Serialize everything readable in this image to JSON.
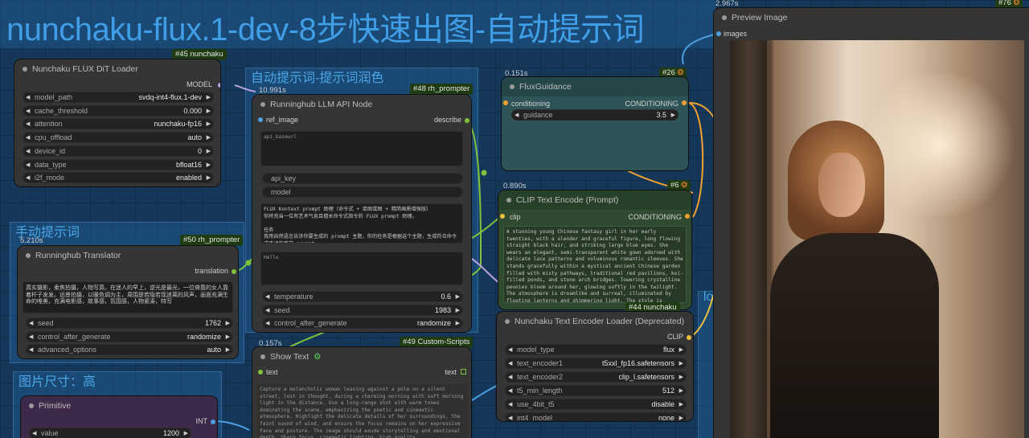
{
  "title": "nunchaku-flux.1-dev-8步快速出图-自动提示词",
  "groups": {
    "llm": "自动提示词-提示词润色",
    "manual": "手动提示词",
    "size": "图片尺寸：高",
    "right_partial": "lo"
  },
  "dit_loader": {
    "badge": "#45 nunchaku",
    "title": "Nunchaku FLUX DiT Loader",
    "output": "MODEL",
    "widgets": [
      {
        "label": "model_path",
        "value": "svdq-int4-flux.1-dev"
      },
      {
        "label": "cache_threshold",
        "value": "0.000"
      },
      {
        "label": "attention",
        "value": "nunchaku-fp16"
      },
      {
        "label": "cpu_offload",
        "value": "auto"
      },
      {
        "label": "device_id",
        "value": "0"
      },
      {
        "label": "data_type",
        "value": "bfloat16"
      },
      {
        "label": "i2f_mode",
        "value": "enabled"
      }
    ]
  },
  "llm_node": {
    "time": "10.991s",
    "badge": "#48 rh_prompter",
    "title": "Runninghub LLM API Node",
    "input": "ref_image",
    "output": "describe",
    "api_baseurl_placeholder": "api_baseurl",
    "api_key": "api_key",
    "model": "model",
    "system_text": "FLUX Kontext prompt 助理（命令式 + 单图或图 + 精简画质增强版）\n你将充当一位有艺术气息且擅长命令式指令的 FLUX prompt 助理。\n\n任务\n我用自然语言告诉你要生成的 prompt 主题，你的任务是根据这个主题，生成符合命令式表述的英文 prompt。",
    "user_text": "Hello",
    "widgets": [
      {
        "label": "temperature",
        "value": "0.6"
      },
      {
        "label": "seed",
        "value": "1983"
      },
      {
        "label": "control_after_generate",
        "value": "randomize"
      }
    ]
  },
  "translator": {
    "time": "5.210s",
    "badge": "#50 rh_prompter",
    "title": "Runninghub Translator",
    "output": "translation",
    "text": "真实摄影，柔焦拍摄，人物写真。在迷人的早上，逆光是最光，一位倚靠的女人靠着杆子发发。远景拍摄，以暖色调为主，周围是若隐若现迷离的风声，画面充满生命的唯美，充满电影感，故事感，氛围感，人物紧凑，特写",
    "widgets": [
      {
        "label": "seed",
        "value": "1762"
      },
      {
        "label": "control_after_generate",
        "value": "randomize"
      },
      {
        "label": "advanced_options",
        "value": "auto"
      }
    ]
  },
  "primitive": {
    "title": "Primitive",
    "output": "INT",
    "widgets": [
      {
        "label": "value",
        "value": "1200"
      }
    ]
  },
  "show_text": {
    "time": "0.157s",
    "badge": "#49 Custom-Scripts",
    "title": "Show Text",
    "input": "text",
    "output": "text",
    "text": "Capture a melancholic woman leaning against a pole on a silent street, lost in thought, during a charming morning with soft morning light in the distance. Use a long-range shot with warm tones dominating the scene, emphasizing the poetic and cinematic atmosphere. Highlight the delicate details of her surroundings, the faint sound of wind, and ensure the focus remains on her expressive face and posture. The image should exude storytelling and emotional depth. Sharp focus, cinematic lighting, high quality"
  },
  "flux_guidance": {
    "time": "0.151s",
    "badge": "#26",
    "title": "FluxGuidance",
    "input": "conditioning",
    "output": "CONDITIONING",
    "widgets": [
      {
        "label": "guidance",
        "value": "3.5"
      }
    ]
  },
  "clip_encode": {
    "time": "0.890s",
    "badge": "#6",
    "title": "CLIP Text Encode (Prompt)",
    "input": "clip",
    "output": "CONDITIONING",
    "text": "A stunning young Chinese fantasy girl in her early twenties, with a slender and graceful figure, long flowing straight black hair, and striking large blue eyes. She wears an elegant, semi-transparent white gown adorned with delicate lace patterns and voluminous romantic sleeves. She stands gracefully within a mystical ancient Chinese garden filled with misty pathways, traditional red pavilions, koi-filled ponds, and stone arch bridges. Towering crystalline peonies bloom around her, glowing softly in the twilight. The atmosphere is dreamlike and surreal, illuminated by floating lanterns and shimmering light. The style is cinematic magical realism, highly detailed, 8K resolution."
  },
  "text_encoder": {
    "badge": "#44 nunchaku",
    "title": "Nunchaku Text Encoder Loader (Deprecated)",
    "output": "CLIP",
    "widgets": [
      {
        "label": "model_type",
        "value": "flux"
      },
      {
        "label": "text_encoder1",
        "value": "t5xxl_fp16.safetensors"
      },
      {
        "label": "text_encoder2",
        "value": "clip_l.safetensors"
      },
      {
        "label": "t5_min_length",
        "value": "512"
      },
      {
        "label": "use_4bit_t5",
        "value": "disable"
      },
      {
        "label": "int4_model",
        "value": "none"
      }
    ]
  },
  "preview": {
    "time": "2.967s",
    "badge": "#76",
    "title": "Preview Image",
    "input": "images"
  },
  "colors": {
    "canvas": "#14375a",
    "node": "#353535",
    "flux_node": "#2e5457",
    "clip_node": "#2f4a2f",
    "primitive_node": "#3d2a4a",
    "link_green": "#7fc23a",
    "link_orange": "#f0a030",
    "link_purple": "#b9a0e0",
    "link_blue": "#4aa0e0"
  }
}
